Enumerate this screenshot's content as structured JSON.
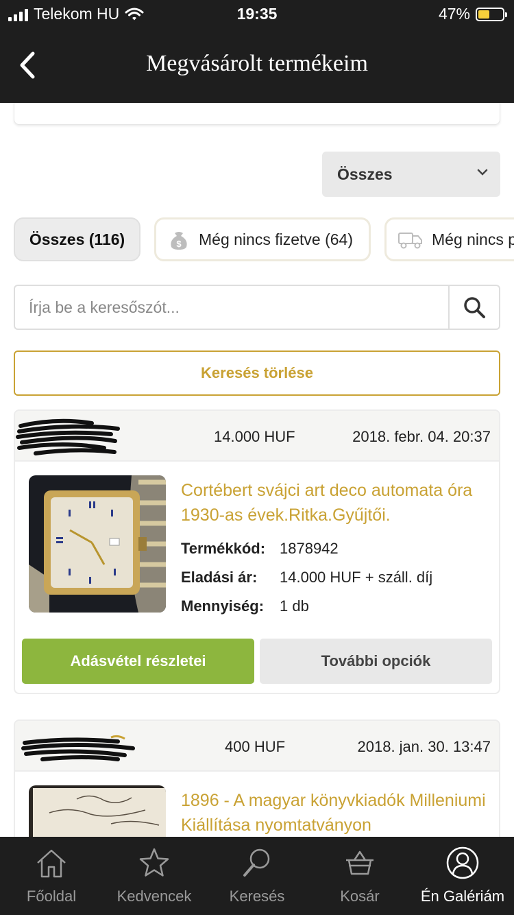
{
  "status_bar": {
    "carrier": "Telekom HU",
    "time": "19:35",
    "battery": "47%",
    "battery_level": 0.47
  },
  "header": {
    "title": "Megvásárolt termékeim",
    "back_icon": "chevron-left-icon"
  },
  "filter_dropdown": {
    "selected": "Összes"
  },
  "chips": [
    {
      "label": "Összes (116)",
      "active": true
    },
    {
      "label": "Még nincs fizetve (64)",
      "icon": "money-bag-icon"
    },
    {
      "label": "Még nincs p",
      "icon": "truck-icon"
    }
  ],
  "search": {
    "placeholder": "Írja be a keresőszót...",
    "value": ""
  },
  "clear_search_label": "Keresés törlése",
  "orders": [
    {
      "price": "14.000 HUF",
      "date": "2018. febr. 04. 20:37",
      "title": "Cortébert svájci art deco automata óra 1930-as évek.Ritka.Gyűjtői.",
      "code_label": "Termékkód:",
      "code": "1878942",
      "sale_price_label": "Eladási ár:",
      "sale_price": "14.000 HUF + száll. díj",
      "qty_label": "Mennyiség:",
      "qty": "1 db",
      "details_button": "Adásvétel részletei",
      "options_button": "További opciók"
    },
    {
      "price": "400 HUF",
      "date": "2018. jan. 30. 13:47",
      "title": "1896 - A magyar könyvkiadók Milleniumi Kiállítása nyomtatványon"
    }
  ],
  "tabbar": [
    {
      "label": "Főoldal",
      "icon": "home-icon"
    },
    {
      "label": "Kedvencek",
      "icon": "star-icon"
    },
    {
      "label": "Keresés",
      "icon": "search-icon"
    },
    {
      "label": "Kosár",
      "icon": "basket-icon"
    },
    {
      "label": "Én Galériám",
      "icon": "user-icon",
      "active": true
    }
  ],
  "colors": {
    "bar": "#1e1e1e",
    "gold": "#c9a234",
    "green": "#8db63e"
  }
}
